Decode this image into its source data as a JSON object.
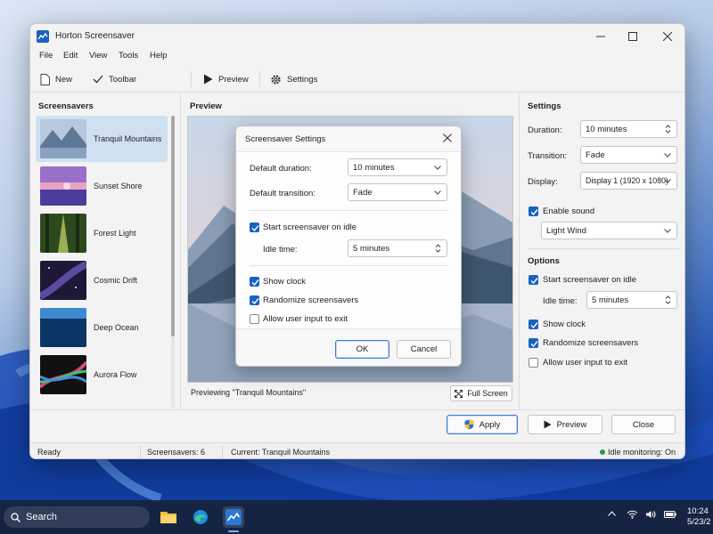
{
  "window": {
    "title": "Horton Screensaver",
    "menu": [
      "File",
      "Edit",
      "View",
      "Tools",
      "Help"
    ],
    "toolbar": {
      "new": "New",
      "toolbar": "Toolbar",
      "preview": "Preview",
      "settings": "Settings"
    }
  },
  "screensavers": {
    "title": "Screensavers",
    "items": [
      {
        "label": "Tranquil Mountains",
        "selected": true
      },
      {
        "label": "Sunset Shore",
        "selected": false
      },
      {
        "label": "Forest Light",
        "selected": false
      },
      {
        "label": "Cosmic Drift",
        "selected": false
      },
      {
        "label": "Deep Ocean",
        "selected": false
      },
      {
        "label": "Aurora Flow",
        "selected": false
      }
    ]
  },
  "preview": {
    "title": "Preview",
    "caption": "Previewing \"Tranquil Mountains\"",
    "fullscreen": "Full Screen"
  },
  "settings": {
    "title": "Settings",
    "duration_label": "Duration:",
    "duration_value": "10 minutes",
    "transition_label": "Transition:",
    "transition_value": "Fade",
    "display_label": "Display:",
    "display_value": "Display 1 (1920 x 1080)",
    "enable_sound": "Enable sound",
    "enable_sound_checked": true,
    "sound_value": "Light Wind",
    "options_title": "Options",
    "start_on_idle": "Start screensaver on idle",
    "start_on_idle_checked": true,
    "idle_label": "Idle time:",
    "idle_value": "5 minutes",
    "show_clock": "Show clock",
    "show_clock_checked": true,
    "randomize": "Randomize screensavers",
    "randomize_checked": true,
    "allow_input": "Allow user input to exit",
    "allow_input_checked": false
  },
  "buttons": {
    "apply": "Apply",
    "preview": "Preview",
    "close": "Close"
  },
  "status": {
    "ready": "Ready",
    "count": "Screensavers: 6",
    "current": "Current: Tranquil Mountains",
    "idle": "Idle monitoring: On",
    "idle_color": "#2e9a44"
  },
  "dialog": {
    "title": "Screensaver Settings",
    "duration_label": "Default duration:",
    "duration_value": "10 minutes",
    "transition_label": "Default transition:",
    "transition_value": "Fade",
    "start_on_idle": "Start screensaver on idle",
    "idle_label": "Idle time:",
    "idle_value": "5 minutes",
    "show_clock": "Show clock",
    "randomize": "Randomize screensavers",
    "allow_input": "Allow user input to exit",
    "ok": "OK",
    "cancel": "Cancel"
  },
  "taskbar": {
    "search_placeholder": "Search",
    "time": "10:24",
    "date": "5/23/2"
  },
  "colors": {
    "accent": "#1a62c2"
  }
}
